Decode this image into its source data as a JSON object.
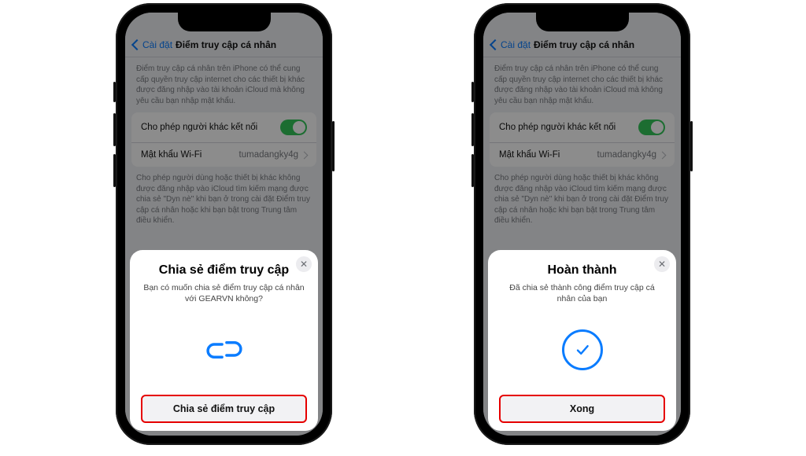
{
  "nav": {
    "back_label": "Cài đặt",
    "title": "Điểm truy cập cá nhân"
  },
  "desc1": "Điểm truy cập cá nhân trên iPhone có thể cung cấp quyền truy cập internet cho các thiết bị khác được đăng nhập vào tài khoản iCloud mà không yêu cầu bạn nhập mật khẩu.",
  "rows": {
    "allow_label": "Cho phép người khác kết nối",
    "pwd_label": "Mật khẩu Wi-Fi",
    "pwd_value": "tumadangky4g"
  },
  "desc2": "Cho phép người dùng hoặc thiết bị khác không được đăng nhập vào iCloud tìm kiếm mạng được chia sẻ \"Dyn nè\" khi bạn ở trong cài đặt Điểm truy cập cá nhân hoặc khi bạn bật trong Trung tâm điều khiển.",
  "sheet1": {
    "title": "Chia sẻ điểm truy cập",
    "sub": "Bạn có muốn chia sẻ điểm truy cập cá nhân với GEARVN              không?",
    "button": "Chia sẻ điểm truy cập"
  },
  "sheet2": {
    "title": "Hoàn thành",
    "sub": "Đã chia sẻ thành công điểm truy cập cá nhân của bạn",
    "button": "Xong"
  }
}
